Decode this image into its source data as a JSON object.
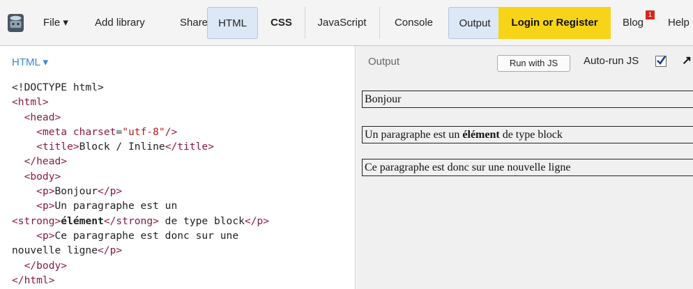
{
  "toolbar": {
    "file_label": "File ▾",
    "add_library_label": "Add library",
    "share_label": "Share",
    "tabs": [
      "HTML",
      "CSS",
      "JavaScript",
      "Console",
      "Output"
    ],
    "login_label": "Login or Register",
    "blog_label": "Blog",
    "blog_badge": "1",
    "help_label": "Help"
  },
  "html_pane": {
    "title": "HTML ▾",
    "code": {
      "doctype": "<!DOCTYPE html>",
      "html_open": "<html>",
      "head_open": "<head>",
      "meta_tag": "<meta",
      "meta_attr": "charset",
      "meta_eq": "=",
      "meta_val": "\"utf-8\"",
      "meta_close": "/>",
      "title_open": "<title>",
      "title_text": "Block / Inline",
      "title_close": "</title>",
      "head_close": "</head>",
      "body_open": "<body>",
      "p_open": "<p>",
      "p1_text": "Bonjour",
      "p_close": "</p>",
      "p2_text": "Un paragraphe est un",
      "strong_open": "<strong>",
      "strong_text": "élément",
      "strong_close": "</strong>",
      "p2_tail": " de type block",
      "p3_text_a": "Ce paragraphe est donc sur une",
      "p3_text_b": "nouvelle ligne",
      "body_close": "</body>",
      "html_close": "</html>"
    }
  },
  "output_pane": {
    "title": "Output",
    "run_button": "Run with JS",
    "autorun_label": "Auto-run JS",
    "expand_icon_glyph": "↗",
    "paragraphs": [
      {
        "before": "Bonjour",
        "strong": "",
        "after": ""
      },
      {
        "before": "Un paragraphe est un ",
        "strong": "élément",
        "after": " de type block"
      },
      {
        "before": "Ce paragraphe est donc sur une nouvelle ligne",
        "strong": "",
        "after": ""
      }
    ]
  },
  "colors": {
    "accent": "#3a85d4",
    "login_bg": "#f7d417",
    "tag": "#8a1a3c",
    "string": "#b61d1d",
    "badge": "#d8261c"
  }
}
